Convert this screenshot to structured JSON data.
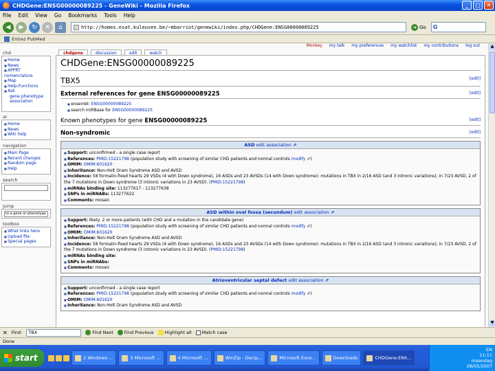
{
  "window": {
    "title": "CHDGene:ENSG00000089225 - GeneWiki - Mozilla Firefox"
  },
  "menu": [
    "File",
    "Edit",
    "View",
    "Go",
    "Bookmarks",
    "Tools",
    "Help"
  ],
  "nav": {
    "url": "http://homes.esat.kuleuven.be/~mbarriot/genewiki/index.php/CHDGene:ENSG00000089225",
    "go_label": "Go",
    "search_value": "G"
  },
  "bookmarks": {
    "item": "Entrez PubMed"
  },
  "personal_tools": [
    "Monkey",
    "my talk",
    "my preferences",
    "my watchlist",
    "my contributions",
    "log out"
  ],
  "sidebar": {
    "chd_label": "chd",
    "chd_items": [
      "Home",
      "News",
      "APPRT nomenclature",
      "Map",
      "Help:Functions",
      "Ask",
      "gene phenotype association"
    ],
    "ar_label": "ar",
    "ar_items": [
      "Home",
      "News",
      "Wiki help"
    ],
    "navigation_label": "navigation",
    "navigation_items": [
      "Main Page",
      "Recent changes",
      "Random page",
      "Help"
    ],
    "search_label": "search",
    "jump_label": "jump",
    "jump_value": "to a gene or phenotype",
    "toolbox_label": "toolbox",
    "toolbox_items": [
      "What links here",
      "Upload file",
      "Special pages"
    ]
  },
  "tabs": [
    "chdgene",
    "discussion",
    "edit",
    "watch"
  ],
  "page": {
    "title": "CHDGene:ENSG00000089225",
    "gene_name": "TBX5",
    "edit_label": "[edit]",
    "ext_refs_heading": "External references for gene ENSG00000089225",
    "ext_refs": [
      {
        "label": "ensembl:",
        "link": "ENSG00000089225"
      },
      {
        "label": "search miRBase for",
        "link": "ENSG00000089225"
      }
    ],
    "phenotypes_heading_prefix": "Known phenotypes for gene ",
    "phenotypes_heading_gene": "ENSG00000089225",
    "non_syndromic": "Non-syndromic"
  },
  "associations": [
    {
      "title": "ASD",
      "edit": "edit association",
      "support_label": "Support:",
      "support": "unconfirmed - a single case report",
      "references_label": "References:",
      "references_link": "PMID:15221798",
      "references_text": "(population study with screening of similar CHD patients and normal controls",
      "modify": "modify",
      "omim_label": "OMIM:",
      "omim": "OMIM:601620",
      "inheritance_label": "Inheritance:",
      "inheritance": "Non-Holt Oram Syndrome ASD and AVSD",
      "incidence_label": "Incidence:",
      "incidence": "58 formalin-fixed hearts 29 VSDs (4 with Down syndrome), 16 ASDs and 23 AVSDs (14 with Down syndrome): mutations in TBX in 2/16 ASD (and 3 intronic variations); in 7/23 AVSD, 2 of the 7 mutations in Down syndrome (3 intronic variations in 23 AVSD).",
      "incidence_link": "PMID:15221798",
      "mirnas_label": "miRNAs binding site:",
      "mirnas": "113277617 - 113277638",
      "snps_label": "SNPs in miRNABs:",
      "snps": "113277622",
      "comments_label": "Comments:",
      "comments": "mosaic"
    },
    {
      "title": "ASD within oval fossa (secundum)",
      "edit": "edit association",
      "support_label": "Support:",
      "support": "likely: 2 or more patients (with CHD and a mutation in the candidate gene)",
      "references_label": "References:",
      "references_link": "PMID:15221798",
      "references_text": "(population study with screening of similar CHD patients and normal controls",
      "modify": "modify",
      "omim_label": "OMIM:",
      "omim": "OMIM:601620",
      "inheritance_label": "Inheritance:",
      "inheritance": "Non-Holt Oram Syndrome ASD and AVSD",
      "incidence_label": "Incidence:",
      "incidence": "58 formalin-fixed hearts 29 VSDs (4 with Down syndrome), 16 ASDs and 23 AVSDs (14 with Down syndrome): mutations in TBX in 2/16 ASD (and 3 intronic variations); in 7/23 AVSD, 2 of the 7 mutations in Down syndrome (3 intronic variations in 23 AVSD).",
      "incidence_link": "PMID:15221798",
      "mirnas_label": "miRNAs binding site:",
      "mirnas": "",
      "snps_label": "SNPs in miRNAbs:",
      "snps": "",
      "comments_label": "Comments:",
      "comments": "mosaic"
    },
    {
      "title": "Atrioventricular septal defect",
      "edit": "edit association",
      "support_label": "Support:",
      "support": "unconfirmed - a single case report",
      "references_label": "References:",
      "references_link": "PMID:15221798",
      "references_text": "(population study with screening of similar CHD patients and normal controls",
      "modify": "modify",
      "omim_label": "OMIM:",
      "omim": "OMIM:601620",
      "inheritance_label": "Inheritance:",
      "inheritance": "Non-Holt Oram Syndrome ASD and AVSD"
    }
  ],
  "findbar": {
    "label": "Find:",
    "value": "TBX",
    "next": "Find Next",
    "previous": "Find Previous",
    "highlight": "Highlight all",
    "match_case": "Match case"
  },
  "status": "Done",
  "taskbar": {
    "start": "start",
    "tasks": [
      "2 Windows ...",
      "3 Microsoft ...",
      "4 Microsoft ...",
      "WinZip - Decip...",
      "Microsoft Exce...",
      "Downloads",
      "CHDGene:ENS..."
    ],
    "language": "EN",
    "time": "11:11",
    "day": "maandag",
    "date": "28/05/2007"
  },
  "colors": {
    "link": "#002bb8",
    "titlebar": "#0a54e3",
    "assoc_head": "#d9e4f2"
  }
}
